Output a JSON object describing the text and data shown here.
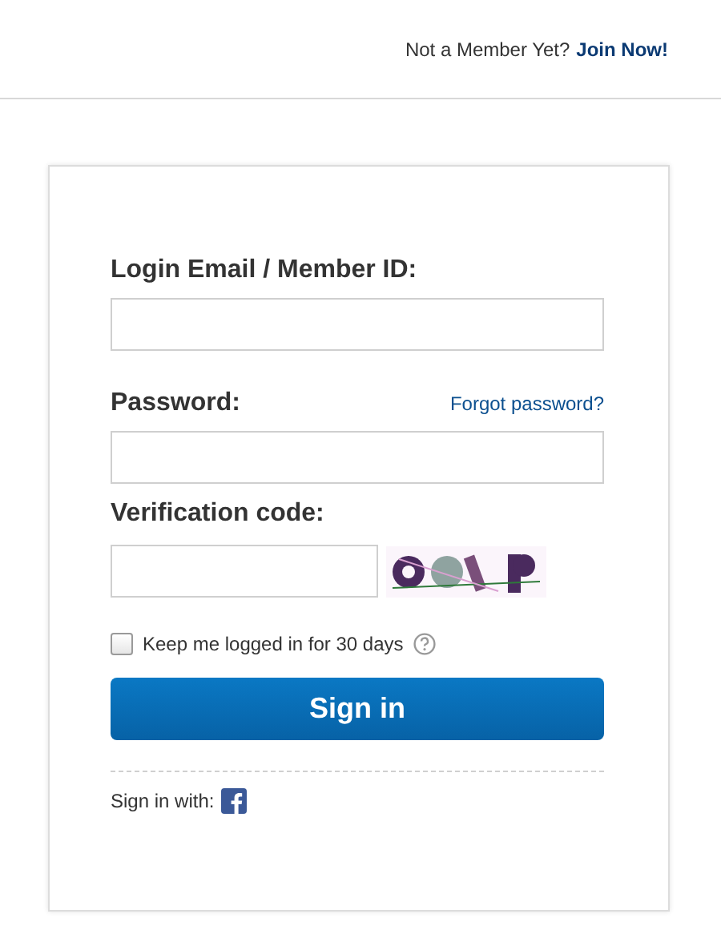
{
  "header": {
    "prompt": "Not a Member Yet?",
    "join_link": "Join Now!"
  },
  "form": {
    "email_label": "Login Email / Member ID:",
    "password_label": "Password:",
    "forgot_link": "Forgot password?",
    "verification_label": "Verification code:",
    "remember": {
      "label": "Keep me logged in for 30 days",
      "checked": false
    },
    "submit": "Sign in",
    "social_label": "Sign in with:"
  }
}
